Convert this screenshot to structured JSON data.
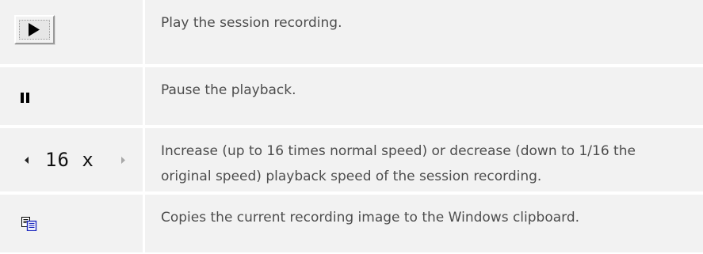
{
  "rows": [
    {
      "icon": "play-icon",
      "description": "Play the session recording."
    },
    {
      "icon": "pause-icon",
      "description": "Pause the playback."
    },
    {
      "icon": "speed-control",
      "speed_value": "16 x",
      "description_line1": "Increase (up to 16 times normal speed) or decrease (down to 1/16 the",
      "description_line2": "original speed) playback speed of the session recording."
    },
    {
      "icon": "copy-icon",
      "description": "Copies the current recording image to the Windows clipboard."
    }
  ],
  "colors": {
    "row_background": "#f2f2f2",
    "text": "#4d4d4d",
    "copy_icon_blue": "#1f2bbf"
  }
}
